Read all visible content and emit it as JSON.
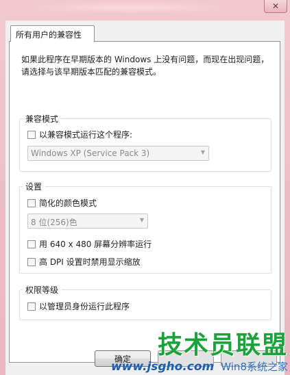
{
  "window": {
    "close_glyph": "✕"
  },
  "tab": {
    "label": "所有用户的兼容性"
  },
  "intro": "如果此程序在早期版本的 Windows 上没有问题，而现在出现问题，请选择与该早期版本匹配的兼容模式。",
  "compat_group": {
    "title": "兼容模式",
    "checkbox_label": "以兼容模式运行这个程序:",
    "checked": false,
    "os_select_value": "Windows XP (Service Pack 3)"
  },
  "settings_group": {
    "title": "设置",
    "reduced_color_label": "简化的颜色模式",
    "color_select_value": "8 位(256)色",
    "resolution_label": "用 640 x 480 屏幕分辨率运行",
    "dpi_label": "高 DPI 设置时禁用显示缩放"
  },
  "privilege_group": {
    "title": "权限等级",
    "admin_label": "以管理员身份运行此程序"
  },
  "buttons": {
    "ok_label": "确定"
  },
  "watermark": {
    "brand": "技术员联盟",
    "url": "www.jsgho.com",
    "win_text": "Win8系统之家"
  }
}
